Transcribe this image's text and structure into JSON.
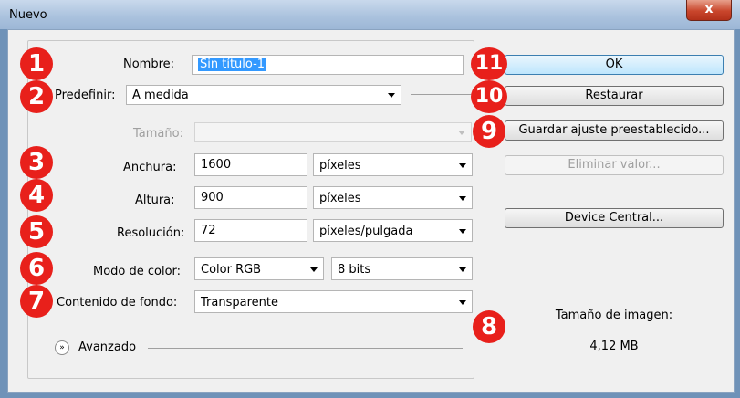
{
  "window": {
    "title": "Nuevo",
    "close_glyph": "x"
  },
  "form": {
    "nombre": {
      "label": "Nombre:",
      "value": "Sin título-1"
    },
    "predefinir": {
      "label": "Predefinir:",
      "value": "A medida"
    },
    "tamano": {
      "label": "Tamaño:",
      "value": ""
    },
    "anchura": {
      "label": "Anchura:",
      "value": "1600",
      "unit": "píxeles"
    },
    "altura": {
      "label": "Altura:",
      "value": "900",
      "unit": "píxeles"
    },
    "resolucion": {
      "label": "Resolución:",
      "value": "72",
      "unit": "píxeles/pulgada"
    },
    "modo_color": {
      "label": "Modo de color:",
      "value": "Color RGB",
      "bits": "8 bits"
    },
    "contenido_fondo": {
      "label": "Contenido de fondo:",
      "value": "Transparente"
    },
    "avanzado": {
      "label": "Avanzado",
      "icon": "chevron-double-down-icon"
    }
  },
  "buttons": {
    "ok": "OK",
    "restaurar": "Restaurar",
    "guardar": "Guardar ajuste preestablecido...",
    "eliminar": "Eliminar valor...",
    "device_central": "Device Central..."
  },
  "image_size": {
    "label": "Tamaño de imagen:",
    "value": "4,12 MB"
  },
  "markers": [
    "1",
    "2",
    "3",
    "4",
    "5",
    "6",
    "7",
    "8",
    "9",
    "10",
    "11"
  ],
  "colors": {
    "marker": "#e8201b",
    "selection": "#3399ff"
  }
}
